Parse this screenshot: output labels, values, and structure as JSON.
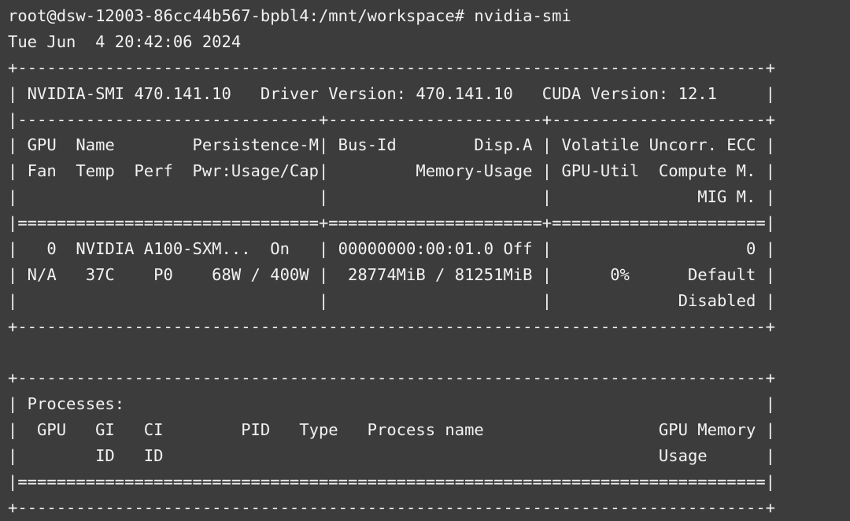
{
  "terminal": {
    "background_color": "#3c3c3c",
    "text_color": "#f2f2f2",
    "prompt_line": "root@dsw-12003-86cc44b567-bpbl4:/mnt/workspace# nvidia-smi",
    "user": "root",
    "host": "dsw-12003-86cc44b567-bpbl4",
    "cwd": "/mnt/workspace",
    "command": "nvidia-smi",
    "timestamp": "Tue Jun  4 20:42:06 2024"
  },
  "smi": {
    "version_line": "| NVIDIA-SMI 470.141.10   Driver Version: 470.141.10   CUDA Version: 12.1     |",
    "nvidia_smi_version": "470.141.10",
    "driver_version": "470.141.10",
    "cuda_version": "12.1",
    "border_top": "+-----------------------------------------------------------------------------+",
    "border_mid_3col": "|-------------------------------+----------------------+----------------------+",
    "border_eq_3col": "|===============================+======================+======================|",
    "border_bottom": "+-----------------------------------------------------------------------------+",
    "header_rows": [
      "| GPU  Name        Persistence-M| Bus-Id        Disp.A | Volatile Uncorr. ECC |",
      "| Fan  Temp  Perf  Pwr:Usage/Cap|         Memory-Usage | GPU-Util  Compute M. |",
      "|                               |                      |               MIG M. |"
    ],
    "gpu_rows": [
      "|   0  NVIDIA A100-SXM...  On   | 00000000:00:01.0 Off |                    0 |",
      "| N/A   37C    P0    68W / 400W |  28774MiB / 81251MiB |      0%      Default |",
      "|                               |                      |             Disabled |"
    ],
    "gpu": {
      "index": "0",
      "name": "NVIDIA A100-SXM...",
      "persistence_m": "On",
      "bus_id": "00000000:00:01.0",
      "disp_a": "Off",
      "uncorr_ecc": "0",
      "fan": "N/A",
      "temp": "37C",
      "perf": "P0",
      "pwr_usage_cap": "68W / 400W",
      "memory_usage": "28774MiB / 81251MiB",
      "memory_used": "28774MiB",
      "memory_total": "81251MiB",
      "gpu_util": "0%",
      "compute_m": "Default",
      "mig_m": "Disabled"
    }
  },
  "processes": {
    "border_top": "+-----------------------------------------------------------------------------+",
    "title_row": "| Processes:                                                                  |",
    "title": "Processes:",
    "header_rows": [
      "|  GPU   GI   CI        PID   Type   Process name                  GPU Memory |",
      "|        ID   ID                                                   Usage      |"
    ],
    "border_eq": "|=============================================================================|",
    "border_bottom": "+-----------------------------------------------------------------------------+",
    "columns": [
      "GPU",
      "GI ID",
      "CI ID",
      "PID",
      "Type",
      "Process name",
      "GPU Memory Usage"
    ],
    "rows": []
  }
}
